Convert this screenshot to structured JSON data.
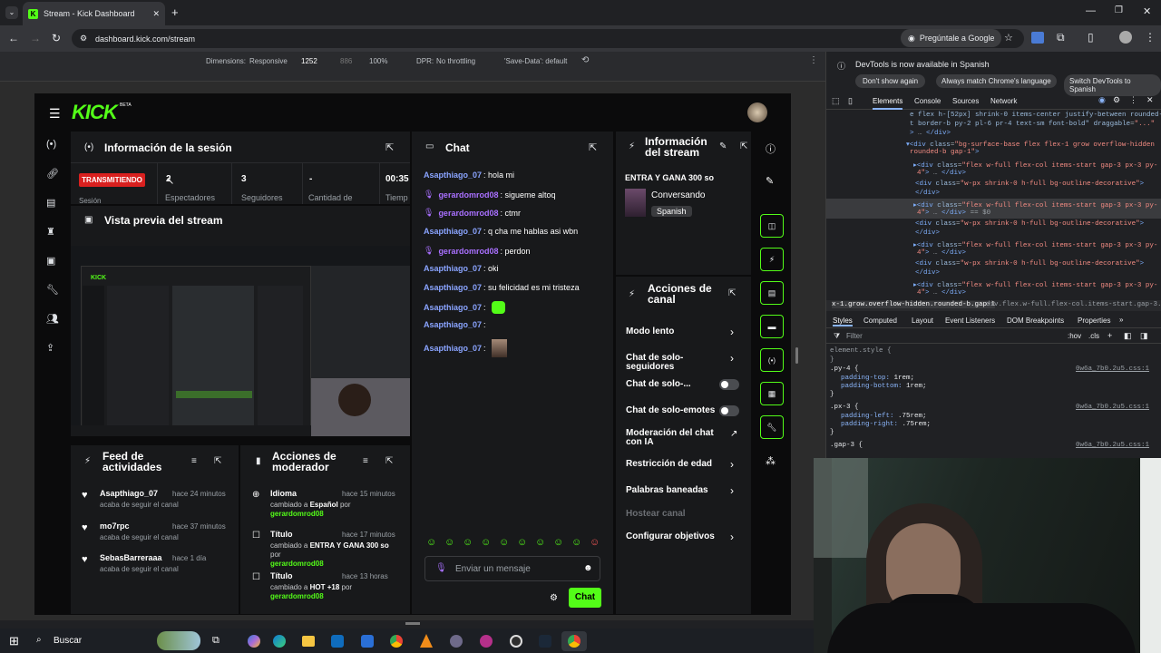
{
  "browser": {
    "tab_title": "Stream - Kick Dashboard",
    "url": "dashboard.kick.com/stream",
    "ask_google": "Pregúntale a Google"
  },
  "devtoolbar": {
    "dimensions_label": "Dimensions:",
    "responsive": "Responsive",
    "width": "1252",
    "height": "886",
    "zoom": "100%",
    "dpr_label": "DPR:",
    "throttle": "No throttling",
    "save_data": "'Save-Data': default"
  },
  "kick": {
    "logo": "KICK",
    "beta": "BETA",
    "session": {
      "title": "Información de la sesión",
      "live_badge": "TRANSMITIENDO",
      "session_label": "Sesión",
      "viewers": "2",
      "viewers_label": "Espectadores",
      "followers": "3",
      "followers_label": "Seguidores",
      "amount": "-",
      "amount_label": "Cantidad de",
      "time": "00:35",
      "time_label": "Tiemp"
    },
    "preview": {
      "title": "Vista previa del stream"
    },
    "chat": {
      "title": "Chat",
      "placeholder": "Enviar un mensaje",
      "send": "Chat",
      "messages": [
        {
          "user": "Asapthiago_07",
          "text": ": hola mi",
          "color": "blue"
        },
        {
          "user": "gerardomrod08",
          "text": ": siguеme altoq",
          "color": "purple",
          "badge": true
        },
        {
          "user": "gerardomrod08",
          "text": ": ctmr",
          "color": "purple",
          "badge": true
        },
        {
          "user": "Asapthiago_07",
          "text": ": q cha me hablas asi wbn",
          "color": "blue"
        },
        {
          "user": "gerardomrod08",
          "text": ": perdon",
          "color": "purple",
          "badge": true
        },
        {
          "user": "Asapthiago_07",
          "text": ": oki",
          "color": "blue"
        },
        {
          "user": "Asapthiago_07",
          "text": ": su felicidad es mi tristeza",
          "color": "blue"
        },
        {
          "user": "Asapthiago_07",
          "text": ":",
          "color": "blue",
          "emote": "green"
        },
        {
          "user": "Asapthiago_07",
          "text": ":",
          "color": "blue"
        },
        {
          "user": "Asapthiago_07",
          "text": ":",
          "color": "blue",
          "emote": "photo"
        }
      ]
    },
    "streaminfo": {
      "title_line1": "Información",
      "title_line2": "del stream",
      "stream_title": "ENTRA Y GANA 300 so",
      "category": "Conversando",
      "language": "Spanish"
    },
    "actions": {
      "title_line1": "Acciones de",
      "title_line2": "canal",
      "items": [
        {
          "label": "Modo lento",
          "type": "arrow"
        },
        {
          "label": "Chat de solo-seguidores",
          "type": "arrow"
        },
        {
          "label": "Chat de solo-...",
          "type": "toggle"
        },
        {
          "label": "Chat de solo-emotes",
          "type": "toggle"
        },
        {
          "label": "Moderación del chat con IA",
          "type": "external"
        },
        {
          "label": "Restricción de edad",
          "type": "arrow"
        },
        {
          "label": "Palabras baneadas",
          "type": "arrow"
        },
        {
          "label": "Hostear canal",
          "type": "disabled"
        },
        {
          "label": "Configurar objetivos",
          "type": "arrow"
        }
      ]
    },
    "feed": {
      "title_line1": "Feed de",
      "title_line2": "actividades",
      "items": [
        {
          "user": "Asapthiago_07",
          "time": "hace 24 minutos",
          "desc": "acaba de seguir el canal"
        },
        {
          "user": "mo7rpc",
          "time": "hace 37 minutos",
          "desc": "acaba de seguir el canal"
        },
        {
          "user": "SebasBarreraaa",
          "time": "hace 1 día",
          "desc": "acaba de seguir el canal"
        }
      ]
    },
    "modactions": {
      "title_line1": "Acciones de",
      "title_line2": "moderador",
      "items": [
        {
          "title": "Idioma",
          "time": "hace 15 minutos",
          "pre": "cambiado a ",
          "value": "Español",
          "by": " por",
          "user": "gerardomrod08"
        },
        {
          "title": "Título",
          "time": "hace 17 minutos",
          "pre": "cambiado a ",
          "value": "ENTRA Y GANA 300 so",
          "by": " por",
          "user": "gerardomrod08"
        },
        {
          "title": "Título",
          "time": "hace 13 horas",
          "pre": "cambiado a ",
          "value": "HOT +18",
          "by": " por",
          "user": "gerardomrod08"
        }
      ]
    }
  },
  "devtools": {
    "notice": "DevTools is now available in Spanish",
    "btn1": "Don't show again",
    "btn2": "Always match Chrome's language",
    "btn3": "Switch DevTools to Spanish",
    "tabs": [
      "Elements",
      "Console",
      "Sources",
      "Network"
    ],
    "breadcrumb1": "x-1.grow.overflow-hidden.rounded-b.gap-1",
    "breadcrumb2": "div.flex.w-full.flex-col.items-start.gap-3.px-3.py-4",
    "style_tabs": [
      "Styles",
      "Computed",
      "Layout",
      "Event Listeners",
      "DOM Breakpoints",
      "Properties"
    ],
    "filter": "Filter",
    "hov": ":hov",
    "cls": ".cls",
    "element_style": "element.style {",
    "close_brace": "}",
    "rules": [
      {
        "sel": ".py-4 {",
        "src": "0w6a_7b0.2u5.css:1",
        "props": [
          "padding-top: 1rem;",
          "padding-bottom: 1rem;"
        ]
      },
      {
        "sel": ".px-3 {",
        "src": "0w6a_7b0.2u5.css:1",
        "props": [
          "padding-left: .75rem;",
          "padding-right: .75rem;"
        ]
      },
      {
        "sel": ".gap-3 {",
        "src": "0w6a_7b0.2u5.css:1",
        "props": []
      }
    ]
  },
  "taskbar": {
    "search": "Buscar"
  }
}
